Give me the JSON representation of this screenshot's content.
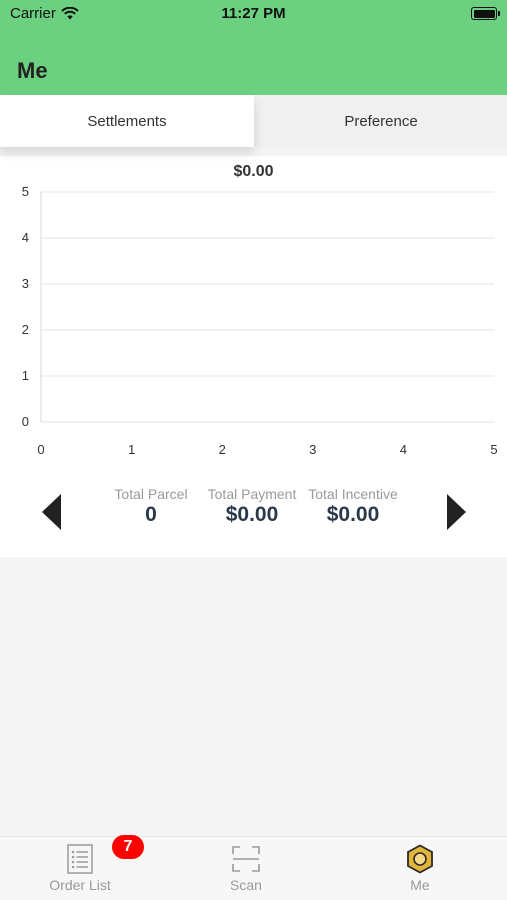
{
  "status_bar": {
    "carrier": "Carrier",
    "time": "11:27 PM"
  },
  "header": {
    "title": "Me"
  },
  "tabs": [
    {
      "label": "Settlements",
      "active": true
    },
    {
      "label": "Preference",
      "active": false
    }
  ],
  "chart_data": {
    "type": "line",
    "title": "$0.00",
    "xlim": [
      0,
      5
    ],
    "ylim": [
      0,
      5
    ],
    "x_ticks": [
      0,
      1,
      2,
      3,
      4,
      5
    ],
    "y_ticks": [
      0,
      1,
      2,
      3,
      4,
      5
    ],
    "grid": true,
    "series": []
  },
  "stats": [
    {
      "label": "Total Parcel",
      "value": "0"
    },
    {
      "label": "Total Payment",
      "value": "$0.00"
    },
    {
      "label": "Total Incentive",
      "value": "$0.00"
    }
  ],
  "tabbar": {
    "items": [
      {
        "label": "Order List",
        "icon": "list-icon",
        "active": false
      },
      {
        "label": "Scan",
        "icon": "scan-icon",
        "active": false
      },
      {
        "label": "Me",
        "icon": "hexagon-user-icon",
        "active": true
      }
    ],
    "badge": "7"
  },
  "colors": {
    "header": "#6bd07f",
    "badge": "#ff0000",
    "active_icon": "#e2b53a"
  }
}
